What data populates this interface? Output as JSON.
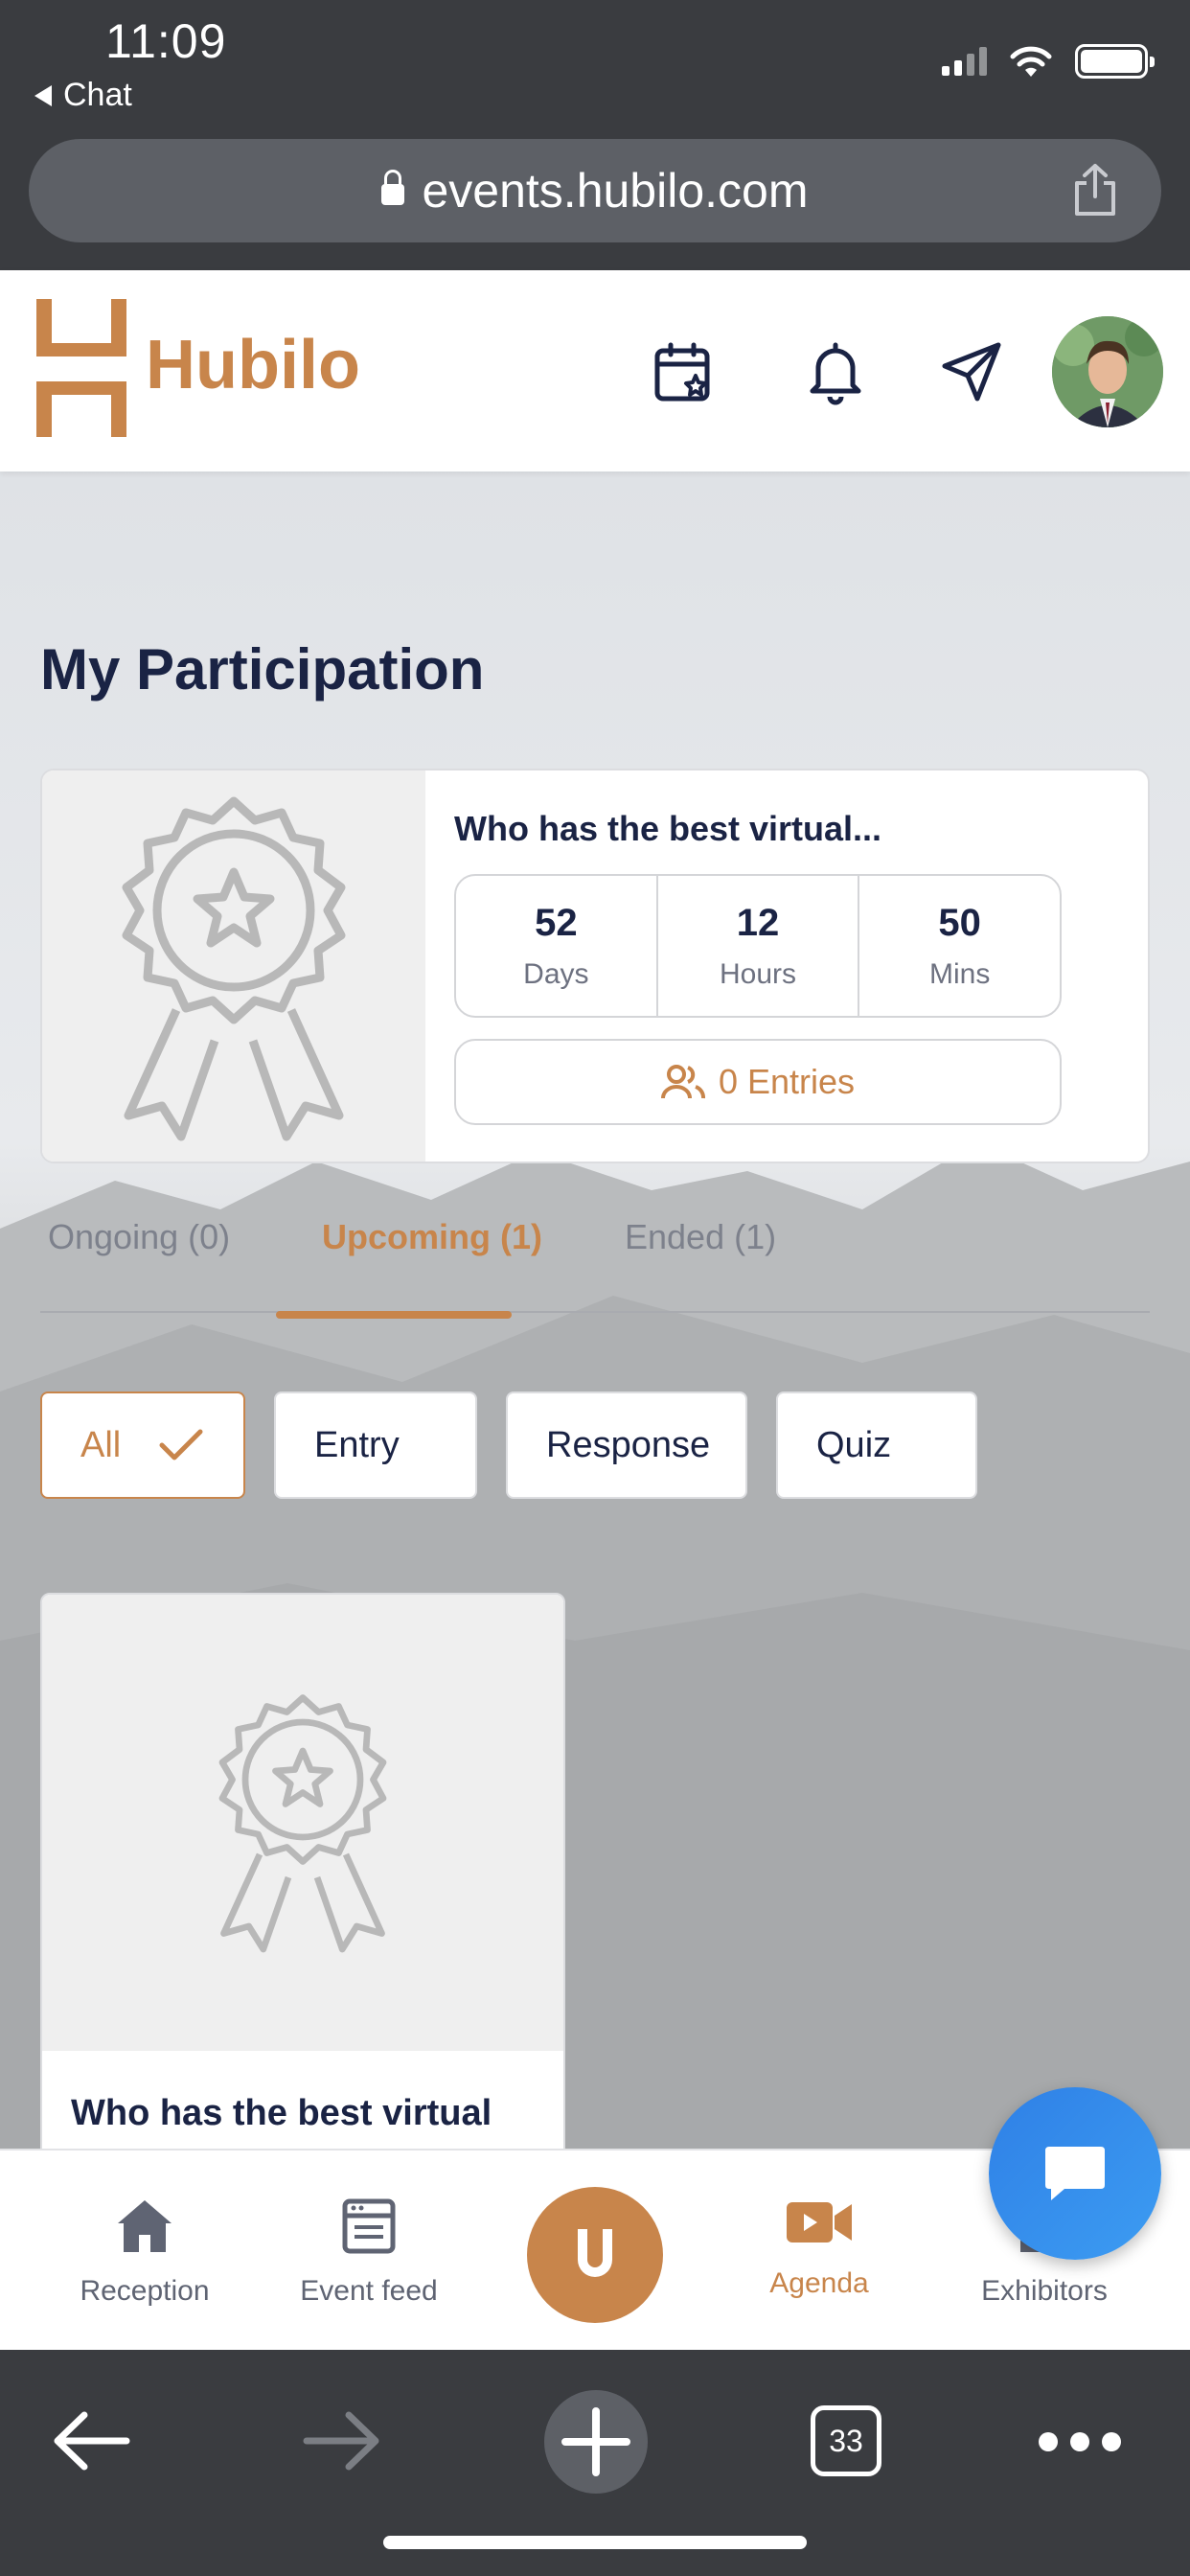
{
  "status_bar": {
    "time": "11:09",
    "back_app": "Chat"
  },
  "browser": {
    "url": "events.hubilo.com",
    "tab_count": "33"
  },
  "header": {
    "brand": "Hubilo"
  },
  "page": {
    "title": "My Participation"
  },
  "featured": {
    "title": "Who has the best virtual...",
    "countdown": [
      {
        "value": "52",
        "label": "Days"
      },
      {
        "value": "12",
        "label": "Hours"
      },
      {
        "value": "50",
        "label": "Mins"
      }
    ],
    "entries_label": "0 Entries"
  },
  "tabs": [
    {
      "label": "Ongoing (0)"
    },
    {
      "label": "Upcoming (1)"
    },
    {
      "label": "Ended (1)"
    }
  ],
  "filters": [
    {
      "label": "All"
    },
    {
      "label": "Entry"
    },
    {
      "label": "Response"
    },
    {
      "label": "Quiz"
    }
  ],
  "list_card": {
    "title": "Who has the best virtual"
  },
  "bottom_nav": [
    {
      "label": "Reception"
    },
    {
      "label": "Event feed"
    },
    {
      "label": "Agenda"
    },
    {
      "label": "Exhibitors"
    }
  ],
  "colors": {
    "accent": "#c8854b",
    "navy": "#1a2344",
    "chat_fab": "#2f80e6"
  }
}
